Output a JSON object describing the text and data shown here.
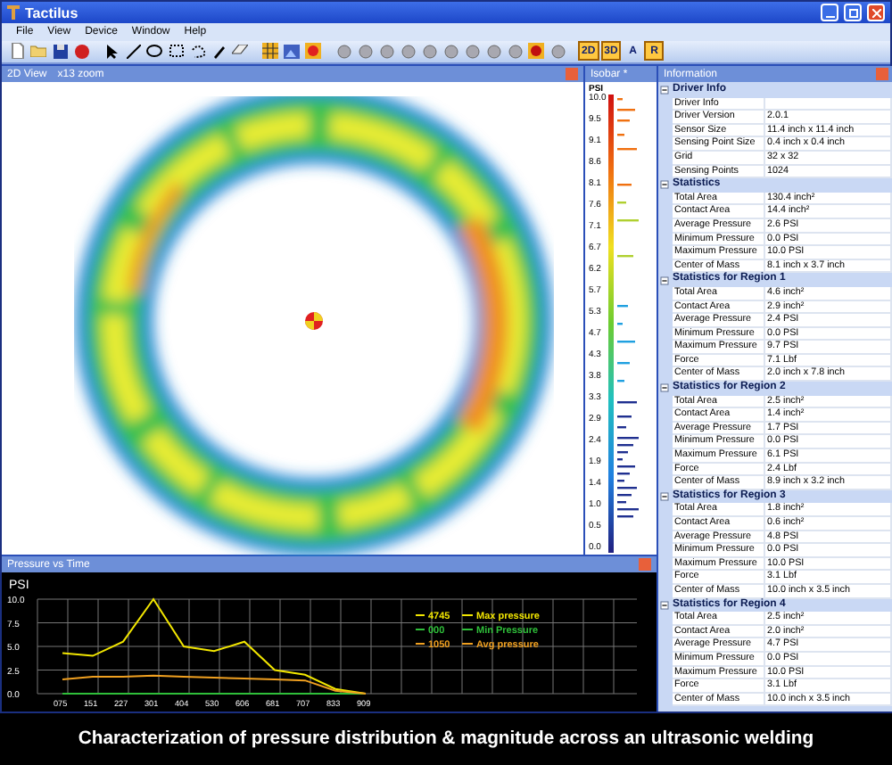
{
  "window": {
    "title": "Tactilus"
  },
  "menu": [
    "File",
    "View",
    "Device",
    "Window",
    "Help"
  ],
  "toolbar": {
    "text_buttons": [
      {
        "label": "2D",
        "selected": true
      },
      {
        "label": "3D",
        "selected": true
      },
      {
        "label": "A",
        "selected": false
      },
      {
        "label": "R",
        "selected": true
      }
    ]
  },
  "view_2d": {
    "title": "2D View",
    "zoom": "x13 zoom"
  },
  "isobar": {
    "title": "Isobar *",
    "unit": "PSI",
    "scale": [
      "10.0",
      "9.5",
      "9.1",
      "8.6",
      "8.1",
      "7.6",
      "7.1",
      "6.7",
      "6.2",
      "5.7",
      "5.3",
      "4.7",
      "4.3",
      "3.8",
      "3.3",
      "2.9",
      "2.4",
      "1.9",
      "1.4",
      "1.0",
      "0.5",
      "0.0"
    ]
  },
  "information": {
    "title": "Information",
    "sections": [
      {
        "title": "Driver Info",
        "expanded": true,
        "rows": [
          {
            "label": "Driver Info",
            "value": ""
          },
          {
            "label": "Driver Version",
            "value": "2.0.1"
          },
          {
            "label": "Sensor Size",
            "value": "11.4 inch x 11.4 inch"
          },
          {
            "label": "Sensing Point Size",
            "value": "0.4 inch x 0.4 inch"
          },
          {
            "label": "Grid",
            "value": "32 x 32"
          },
          {
            "label": "Sensing Points",
            "value": "1024"
          }
        ]
      },
      {
        "title": "Statistics",
        "expanded": true,
        "rows": [
          {
            "label": "Total Area",
            "value": "130.4 inch²"
          },
          {
            "label": "Contact Area",
            "value": "14.4 inch²"
          },
          {
            "label": "Average Pressure",
            "value": "2.6 PSI"
          },
          {
            "label": "Minimum Pressure",
            "value": "0.0 PSI"
          },
          {
            "label": "Maximum Pressure",
            "value": "10.0 PSI"
          },
          {
            "label": "Center of Mass",
            "value": "8.1 inch x 3.7 inch"
          }
        ]
      },
      {
        "title": "Statistics for Region 1",
        "expanded": true,
        "rows": [
          {
            "label": "Total Area",
            "value": "4.6 inch²"
          },
          {
            "label": "Contact Area",
            "value": "2.9 inch²"
          },
          {
            "label": "Average Pressure",
            "value": "2.4 PSI"
          },
          {
            "label": "Minimum Pressure",
            "value": "0.0 PSI"
          },
          {
            "label": "Maximum Pressure",
            "value": "9.7 PSI"
          },
          {
            "label": "Force",
            "value": "7.1 Lbf"
          },
          {
            "label": "Center of Mass",
            "value": "2.0 inch x 7.8 inch"
          }
        ]
      },
      {
        "title": "Statistics for Region 2",
        "expanded": true,
        "rows": [
          {
            "label": "Total Area",
            "value": "2.5 inch²"
          },
          {
            "label": "Contact Area",
            "value": "1.4 inch²"
          },
          {
            "label": "Average Pressure",
            "value": "1.7 PSI"
          },
          {
            "label": "Minimum Pressure",
            "value": "0.0 PSI"
          },
          {
            "label": "Maximum Pressure",
            "value": "6.1 PSI"
          },
          {
            "label": "Force",
            "value": "2.4 Lbf"
          },
          {
            "label": "Center of Mass",
            "value": "8.9 inch x 3.2 inch"
          }
        ]
      },
      {
        "title": "Statistics for Region 3",
        "expanded": true,
        "rows": [
          {
            "label": "Total Area",
            "value": "1.8 inch²"
          },
          {
            "label": "Contact Area",
            "value": "0.6 inch²"
          },
          {
            "label": "Average Pressure",
            "value": "4.8 PSI"
          },
          {
            "label": "Minimum Pressure",
            "value": "0.0 PSI"
          },
          {
            "label": "Maximum Pressure",
            "value": "10.0 PSI"
          },
          {
            "label": "Force",
            "value": "3.1 Lbf"
          },
          {
            "label": "Center of Mass",
            "value": "10.0 inch x 3.5 inch"
          }
        ]
      },
      {
        "title": "Statistics for Region 4",
        "expanded": true,
        "rows": [
          {
            "label": "Total Area",
            "value": "2.5 inch²"
          },
          {
            "label": "Contact Area",
            "value": "2.0 inch²"
          },
          {
            "label": "Average Pressure",
            "value": "4.7 PSI"
          },
          {
            "label": "Minimum Pressure",
            "value": "0.0 PSI"
          },
          {
            "label": "Maximum Pressure",
            "value": "10.0 PSI"
          },
          {
            "label": "Force",
            "value": "3.1 Lbf"
          },
          {
            "label": "Center of Mass",
            "value": "10.0 inch x 3.5 inch"
          }
        ]
      }
    ]
  },
  "pressure_panel": {
    "title": "Pressure vs Time",
    "legend_counts": [
      "4745",
      "000",
      "1050"
    ],
    "chart_data": {
      "type": "line",
      "ylabel": "PSI",
      "categories": [
        "075",
        "151",
        "227",
        "301",
        "404",
        "530",
        "606",
        "681",
        "707",
        "833",
        "909"
      ],
      "ylim": [
        0,
        10
      ],
      "yticks": [
        {
          "value": 0,
          "label": "0.0"
        },
        {
          "value": 2.5,
          "label": "2.5"
        },
        {
          "value": 5,
          "label": "5.0"
        },
        {
          "value": 7.5,
          "label": "7.5"
        },
        {
          "value": 10,
          "label": "10.0"
        }
      ],
      "grid": true,
      "legend": true,
      "series": [
        {
          "name": "Max pressure",
          "color": "#f2e600",
          "values": [
            4.3,
            4.0,
            5.5,
            10.0,
            5.0,
            4.5,
            5.5,
            2.5,
            2.0,
            0.5,
            0.0
          ]
        },
        {
          "name": "Min Pressure",
          "color": "#2fbf3a",
          "values": [
            0,
            0,
            0,
            0,
            0,
            0,
            0,
            0,
            0,
            0,
            0
          ]
        },
        {
          "name": "Avg pressure",
          "color": "#f0a020",
          "values": [
            1.5,
            1.8,
            1.8,
            1.9,
            1.8,
            1.7,
            1.6,
            1.5,
            1.4,
            0.3,
            0.0
          ]
        }
      ]
    }
  },
  "caption": "Characterization of pressure distribution & magnitude across an ultrasonic welding"
}
